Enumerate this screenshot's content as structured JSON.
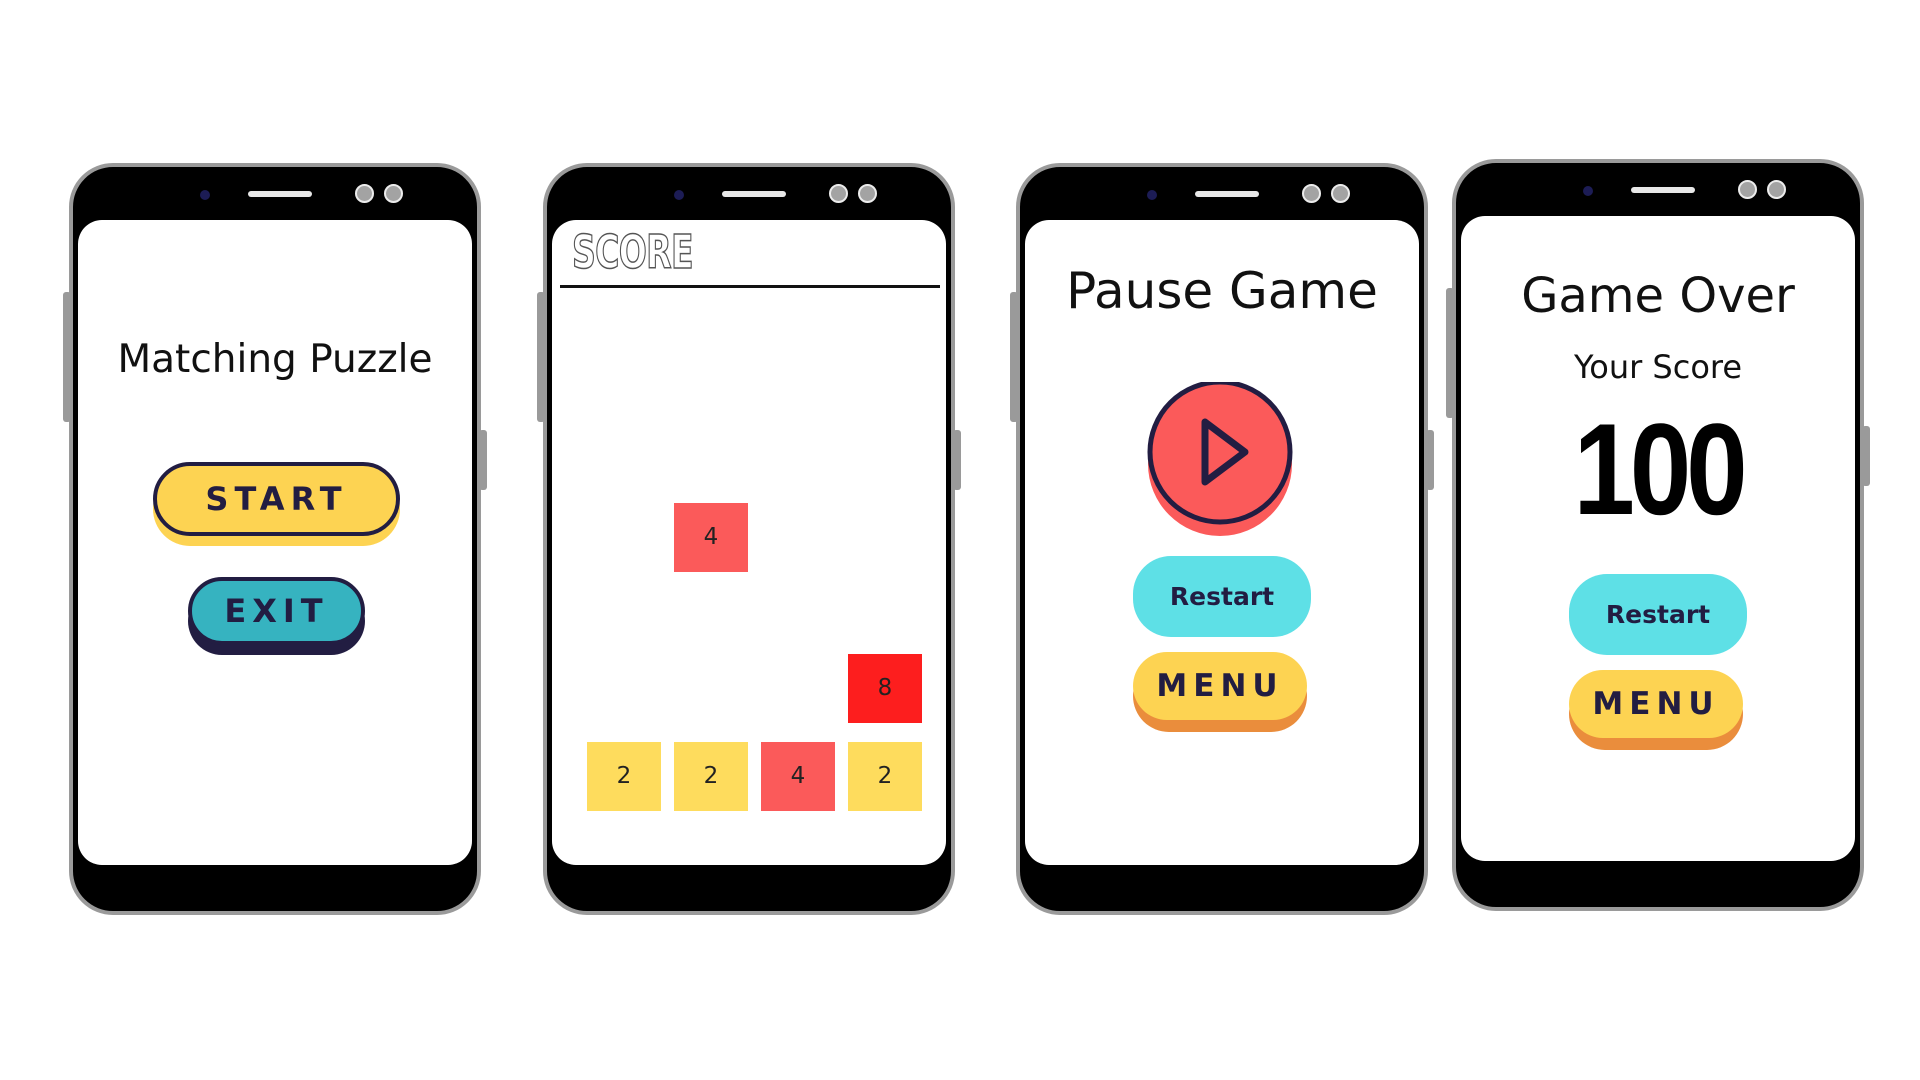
{
  "colors": {
    "yellow": "#fdd352",
    "teal": "#36b3c0",
    "cyan": "#5ee0e6",
    "coral": "#fb5a5a",
    "red": "#fd1e1e",
    "tile_yellow": "#fedc5d",
    "navy": "#221d42",
    "orange_shadow": "#ea8d3c"
  },
  "screens": {
    "start": {
      "title": "Matching Puzzle",
      "start_label": "START",
      "exit_label": "EXIT"
    },
    "game": {
      "score_label": "SCORE",
      "tiles": [
        {
          "value": "4",
          "color": "coral"
        },
        {
          "value": "8",
          "color": "red"
        },
        {
          "value": "2",
          "color": "tile_yellow"
        },
        {
          "value": "2",
          "color": "tile_yellow"
        },
        {
          "value": "4",
          "color": "coral"
        },
        {
          "value": "2",
          "color": "tile_yellow"
        }
      ]
    },
    "pause": {
      "title": "Pause Game",
      "play_icon": "play-icon",
      "restart_label": "Restart",
      "menu_label": "MENU"
    },
    "gameover": {
      "title": "Game Over",
      "score_caption": "Your Score",
      "score_value": "100",
      "restart_label": "Restart",
      "menu_label": "MENU"
    }
  }
}
